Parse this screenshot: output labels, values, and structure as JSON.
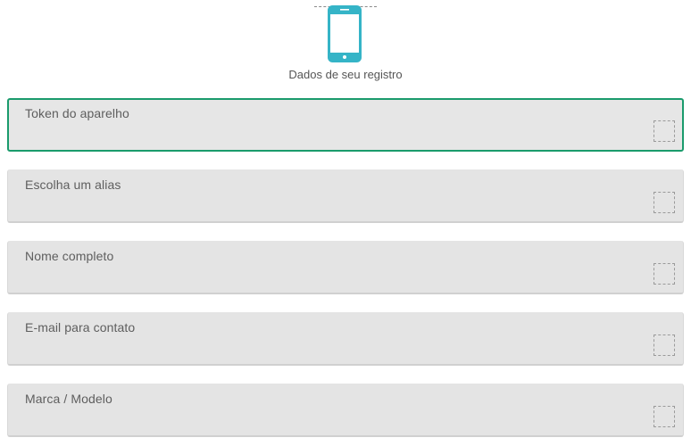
{
  "header": {
    "icon": "smartphone-icon",
    "icon_color": "#35b4c7",
    "subtitle": "Dados de seu registro"
  },
  "form": {
    "accent_color": "#1a9b6c",
    "fields": [
      {
        "label": "Token do aparelho",
        "value": "",
        "active": true
      },
      {
        "label": "Escolha um alias",
        "value": "",
        "active": false
      },
      {
        "label": "Nome completo",
        "value": "",
        "active": false
      },
      {
        "label": "E-mail para contato",
        "value": "",
        "active": false
      },
      {
        "label": "Marca / Modelo",
        "value": "",
        "active": false
      }
    ]
  }
}
